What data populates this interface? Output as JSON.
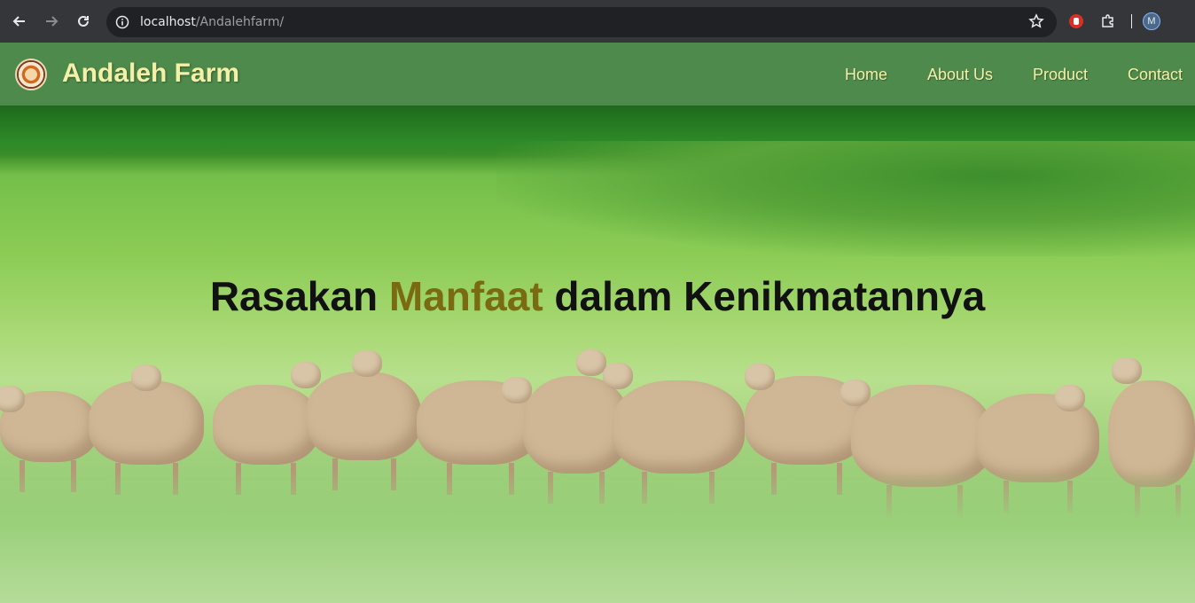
{
  "browser": {
    "url_host": "localhost",
    "url_path": "/Andalehfarm/",
    "profile_initial": "M"
  },
  "site": {
    "brand": "Andaleh Farm",
    "nav": [
      "Home",
      "About Us",
      "Product",
      "Contact"
    ]
  },
  "hero": {
    "title_before": "Rasakan",
    "title_highlight": "Manfaat",
    "title_after": "dalam Kenikmatannya"
  },
  "colors": {
    "header_bg": "#4e8a4c",
    "header_text": "#f5f0a8",
    "highlight": "#7a6b12"
  }
}
